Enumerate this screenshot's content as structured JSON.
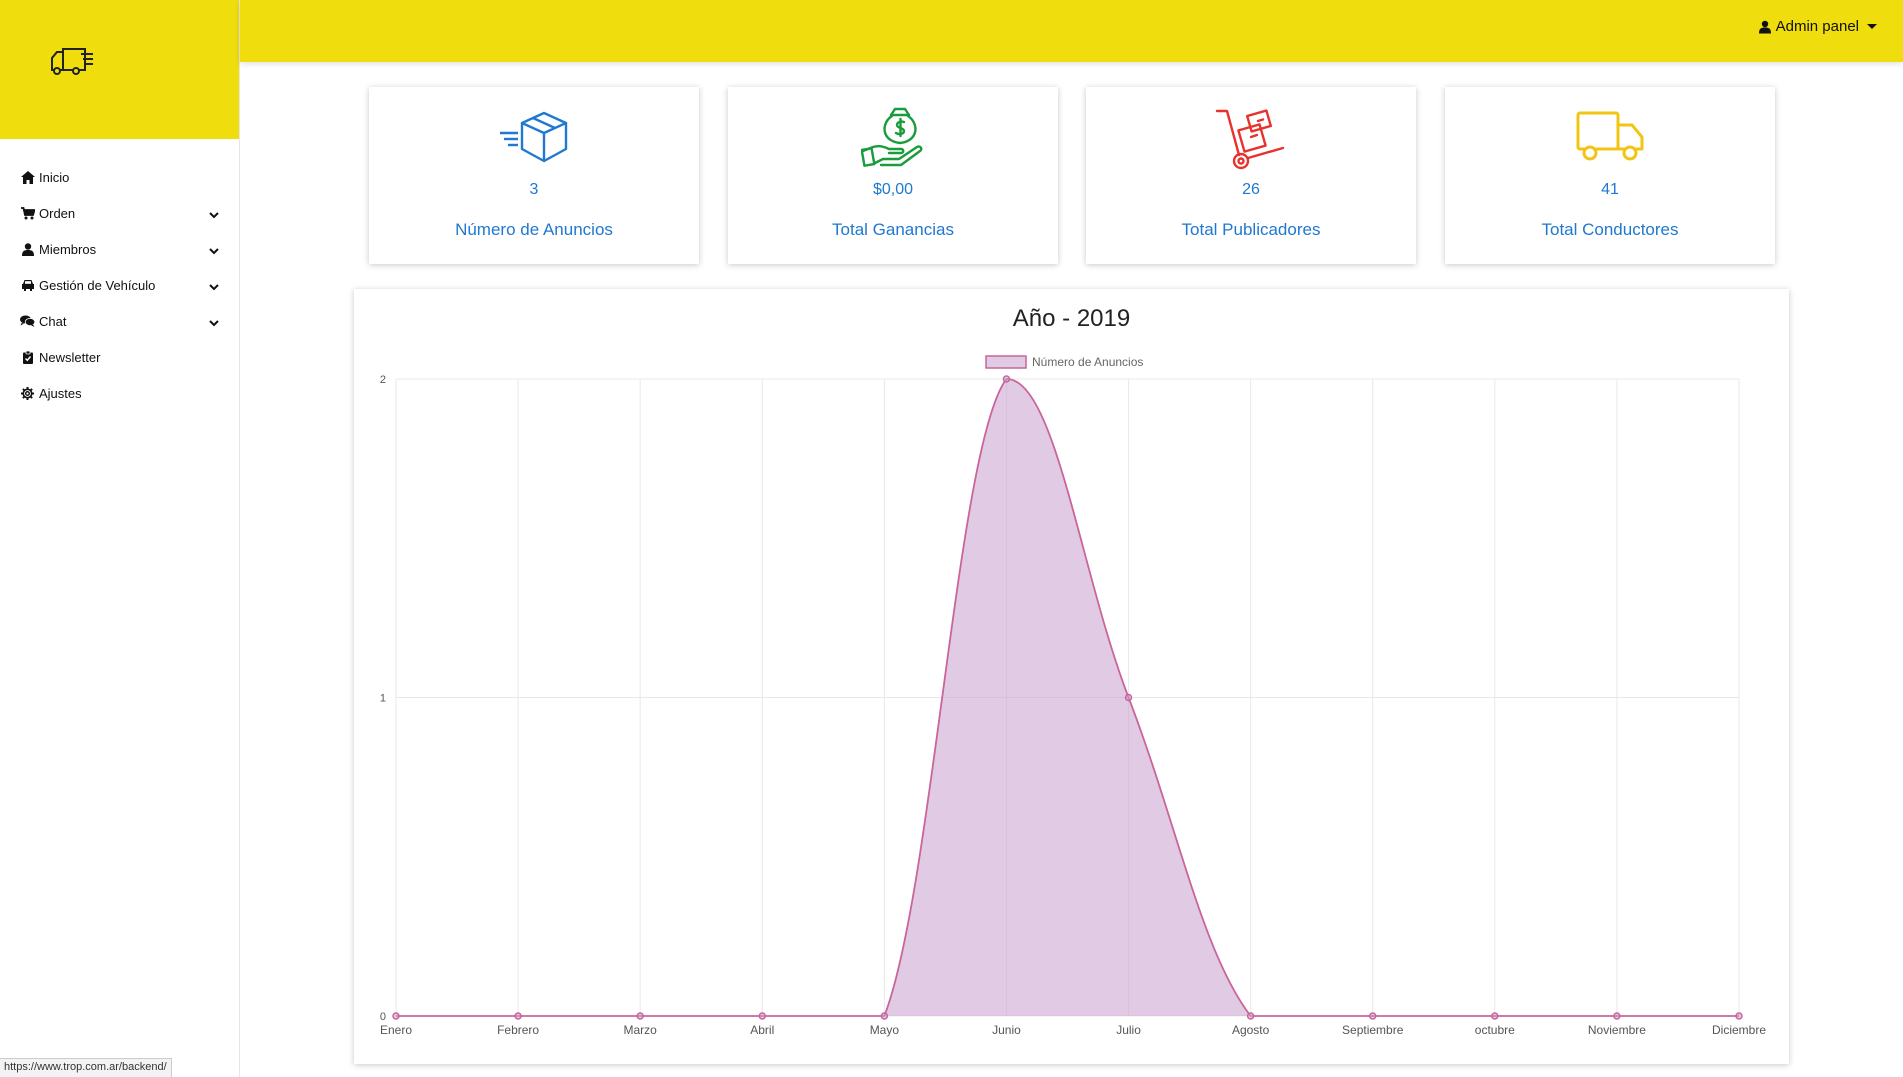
{
  "sidebar": {
    "logo_icon": "delivery-truck-icon",
    "items": [
      {
        "label": "Inicio",
        "icon": "home-icon",
        "expandable": false
      },
      {
        "label": "Orden",
        "icon": "cart-icon",
        "expandable": true
      },
      {
        "label": "Miembros",
        "icon": "user-icon",
        "expandable": true
      },
      {
        "label": "Gestión de Vehículo",
        "icon": "car-icon",
        "expandable": true
      },
      {
        "label": "Chat",
        "icon": "chat-icon",
        "expandable": true
      },
      {
        "label": "Newsletter",
        "icon": "clipboard-check-icon",
        "expandable": false
      },
      {
        "label": "Ajustes",
        "icon": "gear-icon",
        "expandable": false
      }
    ]
  },
  "header": {
    "admin_label": "Admin panel",
    "bg_color": "#efdd0e"
  },
  "stats": [
    {
      "value": "3",
      "label": "Número de Anuncios",
      "icon": "box-icon",
      "icon_color": "#1f78d1"
    },
    {
      "value": "$0,00",
      "label": "Total Ganancias",
      "icon": "money-bag-hand-icon",
      "icon_color": "#1a9b3c"
    },
    {
      "value": "26",
      "label": "Total Publicadores",
      "icon": "hand-truck-icon",
      "icon_color": "#e8322d"
    },
    {
      "value": "41",
      "label": "Total Conductores",
      "icon": "truck-icon",
      "icon_color": "#f2c515"
    }
  ],
  "chart": {
    "title": "Año - 2019"
  },
  "chart_data": {
    "type": "area",
    "categories": [
      "Enero",
      "Febrero",
      "Marzo",
      "Abril",
      "Mayo",
      "Junio",
      "Julio",
      "Agosto",
      "Septiembre",
      "octubre",
      "Noviembre",
      "Diciembre"
    ],
    "series": [
      {
        "name": "Número de Anuncios",
        "values": [
          0,
          0,
          0,
          0,
          0,
          2,
          1,
          0,
          0,
          0,
          0,
          0
        ],
        "color": "#c9659a",
        "fill": "rgba(200,160,205,0.55)"
      }
    ],
    "title": "Año - 2019",
    "xlabel": "",
    "ylabel": "",
    "ylim": [
      0,
      2
    ],
    "yticks": [
      "0",
      "1",
      "2"
    ],
    "grid": true,
    "legend": "top"
  },
  "status_bar": {
    "url": "https://www.trop.com.ar/backend/"
  }
}
